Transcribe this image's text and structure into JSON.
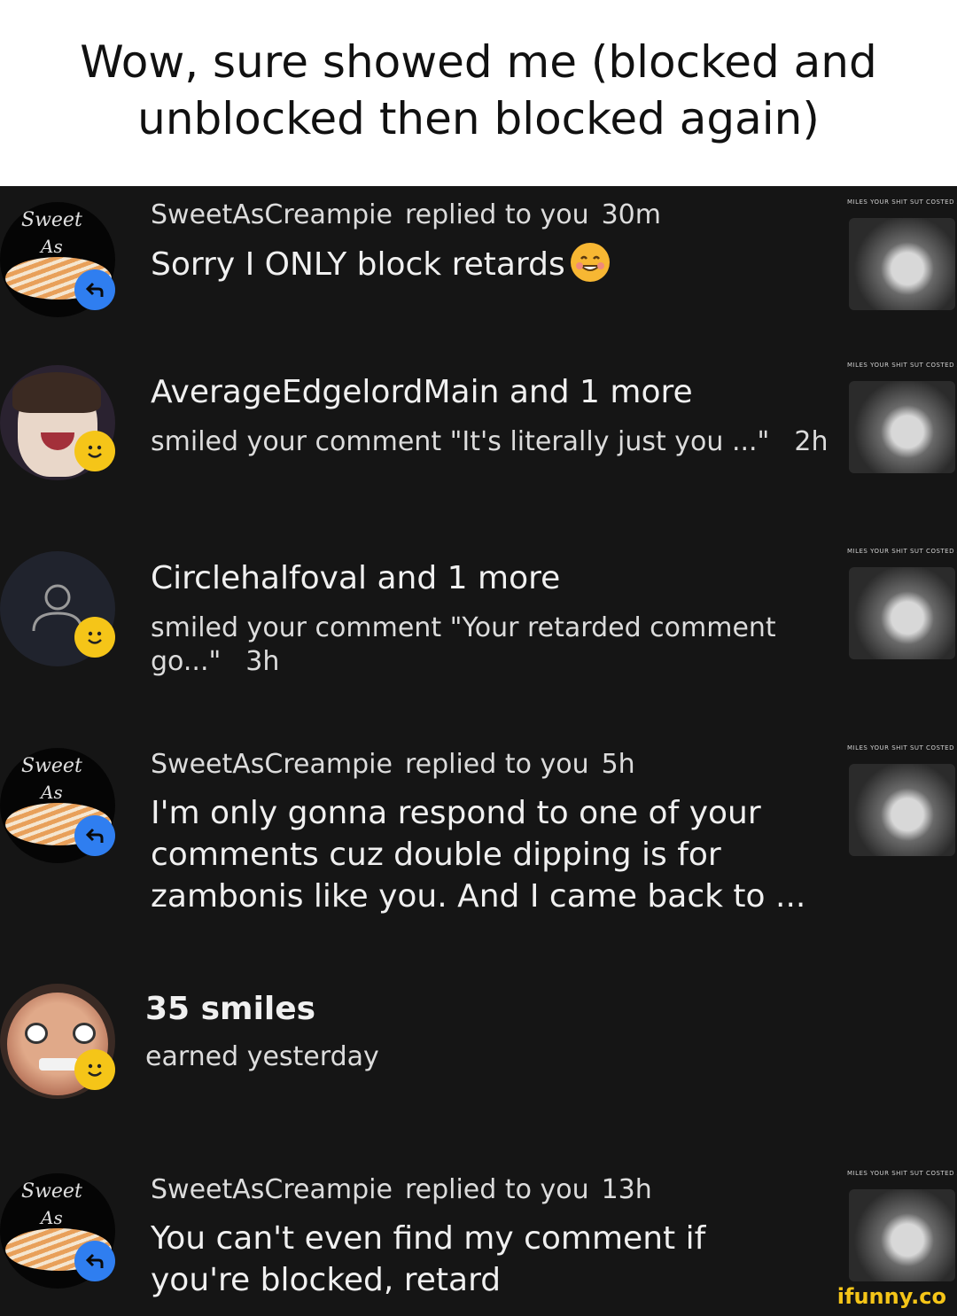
{
  "caption": "Wow, sure showed me (blocked and unblocked then blocked again)",
  "colors": {
    "reply_badge": "#2f7ef0",
    "smile_badge": "#f5c518",
    "background": "#151515",
    "watermark": "#f5c518"
  },
  "thumb_caption": "MILES YOUR SHIT SUT COSTED ALL THE AWARDS",
  "notifications": [
    {
      "avatar_text": [
        "Sweet",
        "As"
      ],
      "badge_icon": "reply-icon",
      "user": "SweetAsCreampie",
      "action": "replied to you",
      "time": "30m",
      "body": "Sorry I ONLY block retards",
      "emoji": "smiling-face-emoji"
    },
    {
      "avatar": "anime-character-avatar",
      "badge_icon": "smile-icon",
      "headline": "AverageEdgelordMain and 1 more",
      "detail": "smiled your comment \"It's literally just you ...\"",
      "time": "2h"
    },
    {
      "avatar": "default-user-icon",
      "badge_icon": "smile-icon",
      "headline": "Circlehalfoval and 1 more",
      "detail": "smiled your comment \"Your retarded comment go...\"",
      "time": "3h"
    },
    {
      "avatar_text": [
        "Sweet",
        "As"
      ],
      "badge_icon": "reply-icon",
      "user": "SweetAsCreampie",
      "action": "replied to you",
      "time": "5h",
      "body": "I'm only gonna respond to one of your comments cuz double dipping is for zambonis like you. And I came back to ..."
    },
    {
      "avatar": "face-photo-avatar",
      "badge_icon": "smile-icon",
      "headline": "35 smiles",
      "detail": "earned yesterday"
    },
    {
      "avatar_text": [
        "Sweet",
        "As"
      ],
      "badge_icon": "reply-icon",
      "user": "SweetAsCreampie",
      "action": "replied to you",
      "time": "13h",
      "body": "You can't even find my comment if you're blocked, retard"
    }
  ],
  "watermark": "ifunny.co"
}
